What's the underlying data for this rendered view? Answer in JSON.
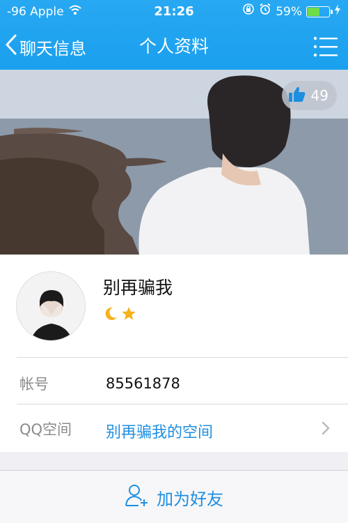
{
  "status_bar": {
    "carrier": "-96 Apple",
    "time": "21:26",
    "battery_percent": "59%",
    "battery_level": 0.59
  },
  "nav": {
    "back_label": "聊天信息",
    "title": "个人资料"
  },
  "cover": {
    "likes_count": "49"
  },
  "profile": {
    "nickname": "别再骗我"
  },
  "rows": {
    "account_label": "帐号",
    "account_value": "85561878",
    "qzone_label": "QQ空间",
    "qzone_value": "别再骗我的空间"
  },
  "bottom_bar": {
    "add_friend_label": "加为好友"
  },
  "colors": {
    "nav_bg": "#1aa0ee",
    "link": "#1e8ee0",
    "battery_fill": "#6fdc4a"
  },
  "icons": [
    "wifi-icon",
    "orientation-lock-icon",
    "alarm-icon",
    "battery-icon",
    "charging-icon",
    "back-chevron-icon",
    "menu-list-icon",
    "thumbs-up-icon",
    "moon-icon",
    "star-icon",
    "chevron-right-icon",
    "add-friend-icon"
  ]
}
